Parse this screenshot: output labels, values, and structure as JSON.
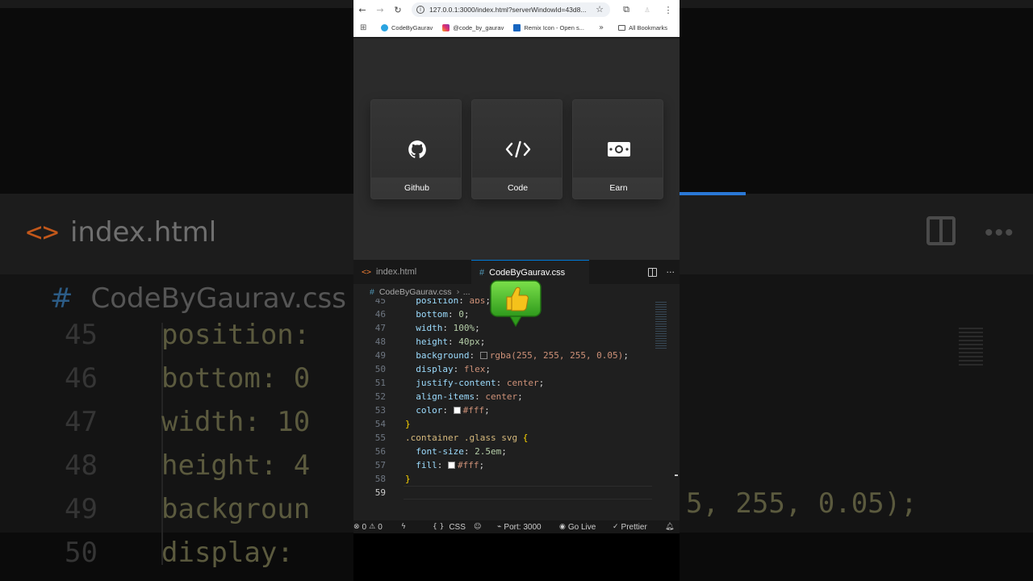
{
  "background": {
    "tab_html_label": "index.html",
    "tab_html_icon": "<>",
    "crumb_hash": "#",
    "crumb_label": "CodeByGaurav.css",
    "code_lines": [
      {
        "num": "45",
        "prop": "position:",
        "val": ""
      },
      {
        "num": "46",
        "prop": "bottom:",
        "val": " 0"
      },
      {
        "num": "47",
        "prop": "width:",
        "val": " 10"
      },
      {
        "num": "48",
        "prop": "height:",
        "val": " 4"
      },
      {
        "num": "49",
        "prop": "backgroun",
        "val": ""
      },
      {
        "num": "50",
        "prop": "display:",
        "val": ""
      }
    ],
    "right_code": "5, 255, 0.05);"
  },
  "browser": {
    "url": "127.0.0.1:3000/index.html?serverWindowId=43d8...",
    "bookmarks": [
      {
        "label": "CodeByGaurav",
        "icon": "telegram-icon"
      },
      {
        "label": "@code_by_gaurav",
        "icon": "instagram-icon"
      },
      {
        "label": "Remix Icon - Open s...",
        "icon": "remix-icon"
      }
    ],
    "all_bookmarks": "All Bookmarks"
  },
  "page": {
    "cards": [
      {
        "label": "Github",
        "icon": "github-icon"
      },
      {
        "label": "Code",
        "icon": "code-icon"
      },
      {
        "label": "Earn",
        "icon": "money-icon"
      }
    ]
  },
  "editor": {
    "tabs": [
      {
        "label": "index.html",
        "icon": "html-file-icon",
        "active": false
      },
      {
        "label": "CodeByGaurav.css",
        "icon": "css-file-icon",
        "active": true
      }
    ],
    "breadcrumb": {
      "file": "CodeByGaurav.css",
      "rest": "..."
    },
    "lines": [
      {
        "num": "45",
        "indent": "  ",
        "prop": "position",
        "value": "abs"
      },
      {
        "num": "46",
        "indent": "  ",
        "prop": "bottom",
        "value": "0"
      },
      {
        "num": "47",
        "indent": "  ",
        "prop": "width",
        "value": "100%"
      },
      {
        "num": "48",
        "indent": "  ",
        "prop": "height",
        "value": "40px"
      },
      {
        "num": "49",
        "indent": "  ",
        "prop": "background",
        "value": "rgba(255, 255, 255, 0.05)"
      },
      {
        "num": "50",
        "indent": "  ",
        "prop": "display",
        "value": "flex"
      },
      {
        "num": "51",
        "indent": "  ",
        "prop": "justify-content",
        "value": "center"
      },
      {
        "num": "52",
        "indent": "  ",
        "prop": "align-items",
        "value": "center"
      },
      {
        "num": "53",
        "indent": "  ",
        "prop": "color",
        "value": "#fff"
      },
      {
        "num": "54",
        "text": "}"
      },
      {
        "num": "55",
        "text": ".container .glass svg {"
      },
      {
        "num": "56",
        "indent": "  ",
        "prop": "font-size",
        "value": "2.5em"
      },
      {
        "num": "57",
        "indent": "  ",
        "prop": "fill",
        "value": "#fff"
      },
      {
        "num": "58",
        "text": "}"
      },
      {
        "num": "59",
        "text": ""
      }
    ]
  },
  "statusbar": {
    "errors": "0",
    "warnings": "0",
    "language": "CSS",
    "language_icon": "{ }",
    "port": "Port: 3000",
    "golive": "Go Live",
    "prettier": "Prettier"
  },
  "colors": {
    "accent": "#0078d4",
    "page_bg": "#2b2b2b",
    "editor_bg": "#1f1f1f"
  }
}
